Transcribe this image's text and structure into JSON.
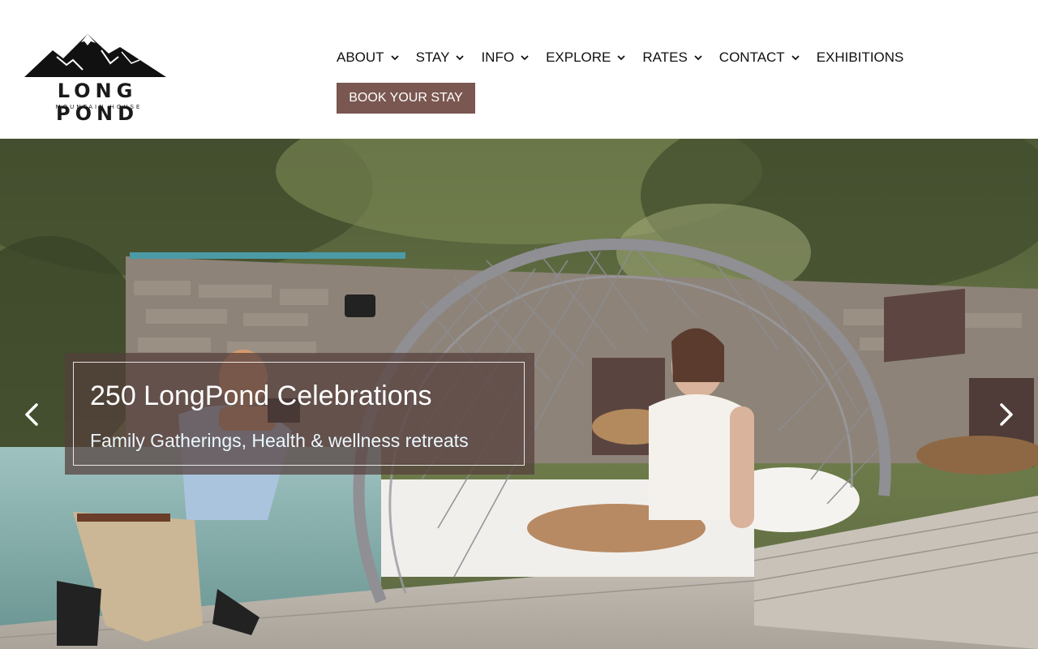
{
  "logo": {
    "title": "LONG POND",
    "subtitle": "MOUNTAIN HOUSE"
  },
  "nav": {
    "items": [
      {
        "label": "ABOUT",
        "has_dropdown": true
      },
      {
        "label": "STAY",
        "has_dropdown": true
      },
      {
        "label": "INFO",
        "has_dropdown": true
      },
      {
        "label": "EXPLORE",
        "has_dropdown": true
      },
      {
        "label": "RATES",
        "has_dropdown": true
      },
      {
        "label": "CONTACT",
        "has_dropdown": true
      },
      {
        "label": "EXHIBITIONS",
        "has_dropdown": false
      }
    ],
    "book_label": "BOOK YOUR STAY"
  },
  "hero": {
    "caption_title": "250 LongPond Celebrations",
    "caption_subtitle": "Family Gatherings, Health & wellness retreats",
    "prev_icon": "chevron-left-icon",
    "next_icon": "chevron-right-icon"
  },
  "colors": {
    "book_button_bg": "#7a5750",
    "caption_bg": "#553e3c",
    "nav_text": "#111111"
  }
}
